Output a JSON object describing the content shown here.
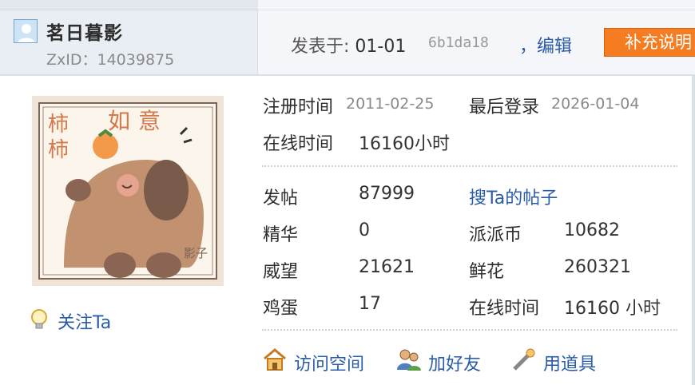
{
  "author": {
    "username": "茗日暮影",
    "zxid_label": "ZxID：",
    "zxid_value": "14039875"
  },
  "post_header": {
    "posted_label": "发表于:",
    "date": "01-01",
    "hash": "6b1da18",
    "edit_label": "，编辑",
    "supplement_label": "补充说明"
  },
  "profile": {
    "register_label": "注册时间",
    "register_value": "2011-02-25",
    "last_login_label": "最后登录",
    "last_login_value": "2026-01-04",
    "online_label": "在线时间",
    "online_value": "16160小时"
  },
  "stats": {
    "posts_label": "发帖",
    "posts_value": "87999",
    "search_posts_link": "搜Ta的帖子",
    "digest_label": "精华",
    "digest_value": "0",
    "coins_label": "派派币",
    "coins_value": "10682",
    "prestige_label": "威望",
    "prestige_value": "21621",
    "flowers_label": "鲜花",
    "flowers_value": "260321",
    "eggs_label": "鸡蛋",
    "eggs_value": "17",
    "online2_label": "在线时间",
    "online2_value": "16160 小时"
  },
  "sidebar": {
    "follow_label": "关注Ta"
  },
  "avatar": {
    "text_top": "如意",
    "text_left": "柿柿",
    "signature": "影子"
  },
  "actions": [
    {
      "label": "访问空间",
      "icon": "home-icon"
    },
    {
      "label": "加好友",
      "icon": "add-friend-icon"
    },
    {
      "label": "用道具",
      "icon": "magic-wand-icon"
    }
  ],
  "colors": {
    "link": "#2a5ca8",
    "accent_button": "#f57c20",
    "header_bg": "#e9eef4"
  }
}
